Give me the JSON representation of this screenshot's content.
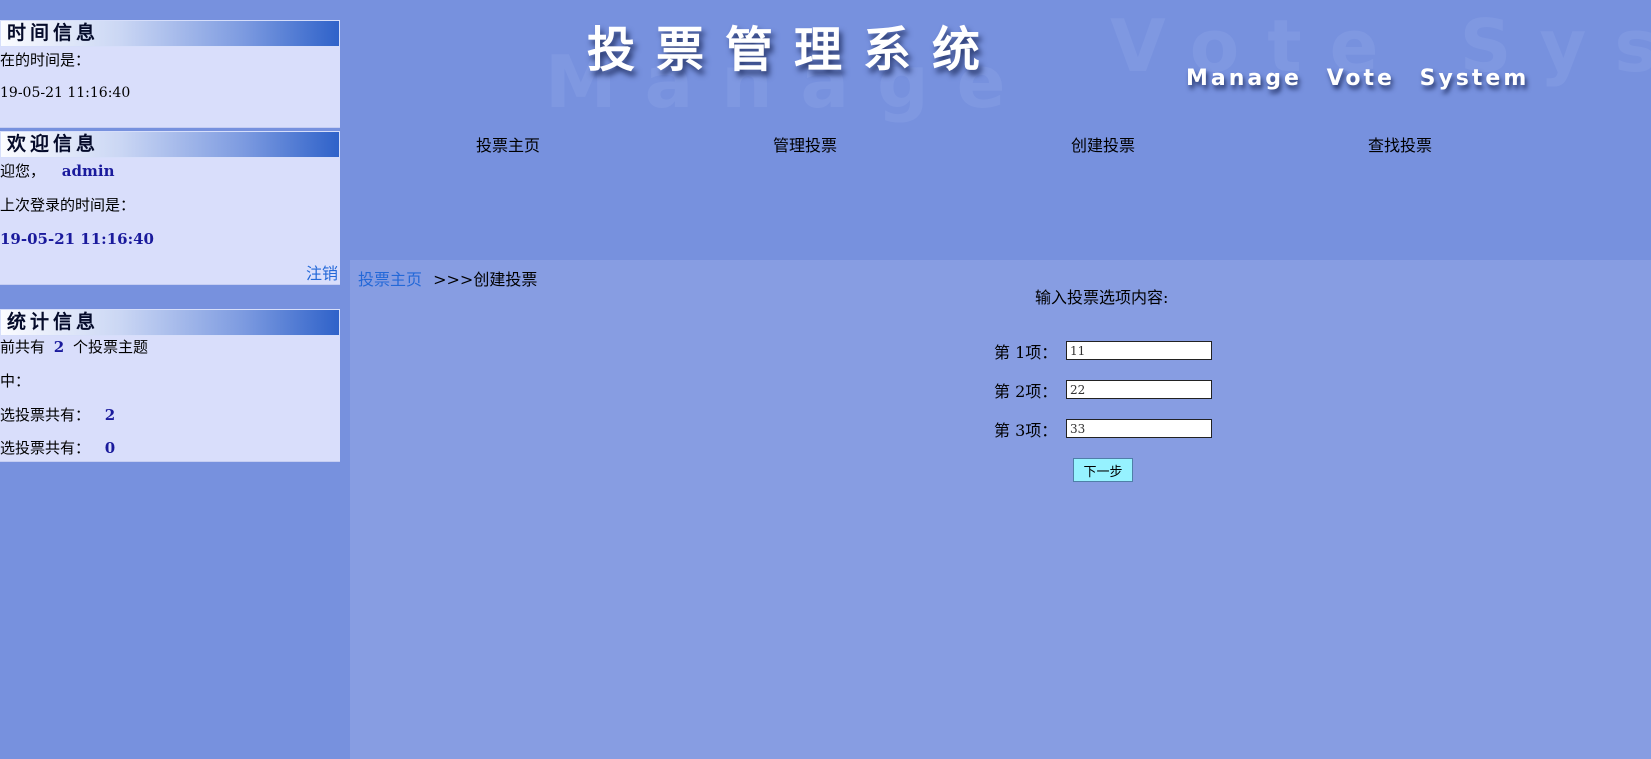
{
  "sidebar": {
    "time_panel": {
      "title": "时间信息",
      "label": "在的时间是：",
      "value": "19-05-21 11:16:40"
    },
    "welcome_panel": {
      "title": "欢迎信息",
      "greeting": "迎您，",
      "username": "admin",
      "last_login_label": "上次登录的时间是：",
      "last_login_value": "19-05-21 11:16:40",
      "logout": "注销"
    },
    "stats_panel": {
      "title": "统计信息",
      "topics_prefix": "前共有",
      "topics_count": "2",
      "topics_suffix": "个投票主题",
      "line2": "中：",
      "line3_label": "选投票共有：",
      "line3_value": "2",
      "line4_label": "选投票共有：",
      "line4_value": "0"
    }
  },
  "header": {
    "title_cn": "投票管理系统",
    "title_en": "Manage Vote System",
    "watermark_1": "Manage",
    "watermark_2": "Vote Sys"
  },
  "nav": {
    "items": [
      {
        "label": "投票主页"
      },
      {
        "label": "管理投票"
      },
      {
        "label": "创建投票"
      },
      {
        "label": "查找投票"
      }
    ]
  },
  "breadcrumb": {
    "home": "投票主页",
    "separator": ">>>",
    "current": "创建投票"
  },
  "form": {
    "title": "输入投票选项内容:",
    "options": [
      {
        "label": "第 1项：",
        "value": "11"
      },
      {
        "label": "第 2项：",
        "value": "22"
      },
      {
        "label": "第 3项：",
        "value": "33"
      }
    ],
    "next_button": "下一步"
  },
  "colors": {
    "background": "#7791de",
    "content_background": "#879de2",
    "panel_background": "#d9defb",
    "link": "#2368d8",
    "value_text": "#1a1a9c",
    "button": "#96f2ff"
  }
}
